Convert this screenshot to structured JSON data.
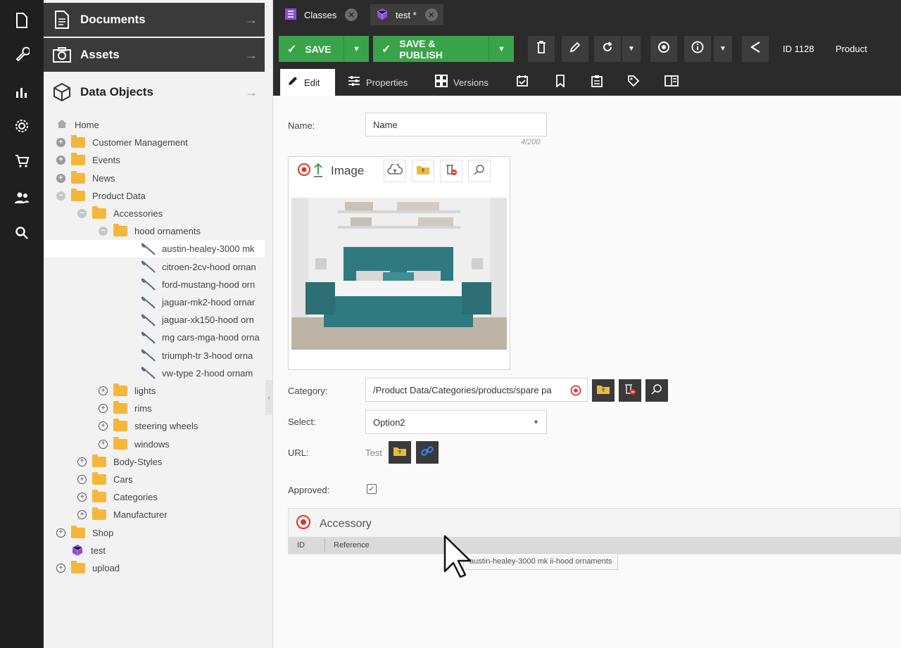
{
  "rail": {
    "icons": [
      "document-icon",
      "wrench-icon",
      "chart-icon",
      "settings-icon",
      "cart-icon",
      "users-icon",
      "search-icon"
    ]
  },
  "nav": {
    "documents_label": "Documents",
    "assets_label": "Assets",
    "data_objects_label": "Data Objects",
    "tree": [
      {
        "label": "Home",
        "icon": "home",
        "depth": 0,
        "toggle": "none"
      },
      {
        "label": "Customer Management",
        "icon": "folder",
        "depth": 0,
        "toggle": "plus"
      },
      {
        "label": "Events",
        "icon": "folder",
        "depth": 0,
        "toggle": "plus"
      },
      {
        "label": "News",
        "icon": "folder",
        "depth": 0,
        "toggle": "plus"
      },
      {
        "label": "Product Data",
        "icon": "folder",
        "depth": 0,
        "toggle": "minus"
      },
      {
        "label": "Accessories",
        "icon": "folder",
        "depth": 1,
        "toggle": "minus"
      },
      {
        "label": "hood ornaments",
        "icon": "folder",
        "depth": 2,
        "toggle": "minus"
      },
      {
        "label": "austin-healey-3000 mk",
        "icon": "wrench",
        "depth": 3,
        "toggle": "none",
        "selected": true
      },
      {
        "label": "citroen-2cv-hood ornan",
        "icon": "wrench",
        "depth": 3,
        "toggle": "none"
      },
      {
        "label": "ford-mustang-hood orn",
        "icon": "wrench",
        "depth": 3,
        "toggle": "none"
      },
      {
        "label": "jaguar-mk2-hood ornar",
        "icon": "wrench",
        "depth": 3,
        "toggle": "none"
      },
      {
        "label": "jaguar-xk150-hood orn",
        "icon": "wrench",
        "depth": 3,
        "toggle": "none"
      },
      {
        "label": "mg cars-mga-hood orna",
        "icon": "wrench",
        "depth": 3,
        "toggle": "none"
      },
      {
        "label": "triumph-tr 3-hood orna",
        "icon": "wrench",
        "depth": 3,
        "toggle": "none"
      },
      {
        "label": "vw-type 2-hood ornam",
        "icon": "wrench",
        "depth": 3,
        "toggle": "none"
      },
      {
        "label": "lights",
        "icon": "folder",
        "depth": 2,
        "toggle": "ring"
      },
      {
        "label": "rims",
        "icon": "folder",
        "depth": 2,
        "toggle": "ring"
      },
      {
        "label": "steering wheels",
        "icon": "folder",
        "depth": 2,
        "toggle": "ring"
      },
      {
        "label": "windows",
        "icon": "folder",
        "depth": 2,
        "toggle": "ring"
      },
      {
        "label": "Body-Styles",
        "icon": "folder",
        "depth": 1,
        "toggle": "ring"
      },
      {
        "label": "Cars",
        "icon": "folder",
        "depth": 1,
        "toggle": "ring"
      },
      {
        "label": "Categories",
        "icon": "folder",
        "depth": 1,
        "toggle": "ring"
      },
      {
        "label": "Manufacturer",
        "icon": "folder",
        "depth": 1,
        "toggle": "ring"
      },
      {
        "label": "Shop",
        "icon": "folder",
        "depth": 0,
        "toggle": "ring"
      },
      {
        "label": "test",
        "icon": "cube",
        "depth": 0,
        "toggle": "none"
      },
      {
        "label": "upload",
        "icon": "folder",
        "depth": 0,
        "toggle": "ring"
      }
    ]
  },
  "tabs": {
    "classes": "Classes",
    "test": "test *"
  },
  "toolbar": {
    "save": "SAVE",
    "save_publish": "SAVE & PUBLISH",
    "id": "ID 1128",
    "class": "Product"
  },
  "subtabs": {
    "edit": "Edit",
    "properties": "Properties",
    "versions": "Versions"
  },
  "form": {
    "name_label": "Name:",
    "name_value": "Name",
    "name_counter": "4/200",
    "image_title": "Image",
    "category_label": "Category:",
    "category_value": "/Product Data/Categories/products/spare pa",
    "select_label": "Select:",
    "select_value": "Option2",
    "url_label": "URL:",
    "url_value": "Test",
    "approved_label": "Approved:",
    "approved": true
  },
  "accessory": {
    "title": "Accessory",
    "col_id": "ID",
    "col_reference": "Reference",
    "drag_tooltip": "austin-healey-3000 mk ii-hood ornaments"
  },
  "colors": {
    "accent_green": "#3aa34a",
    "rail_bg": "#1f1f1f",
    "toolbar_bg": "#2b2b2b",
    "folder": "#f5b73b",
    "target_red": "#e0342f",
    "cube_purple": "#8a4fd8"
  }
}
